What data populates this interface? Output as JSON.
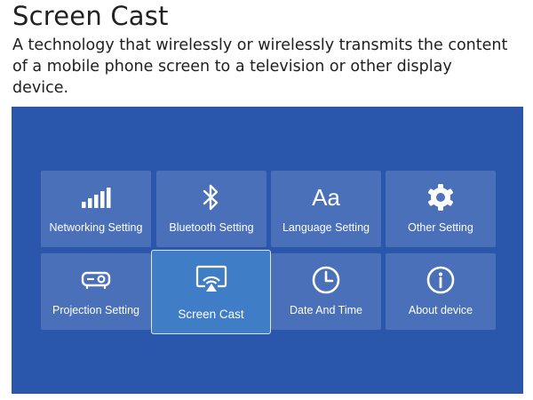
{
  "header": {
    "title": "Screen Cast",
    "description": "A technology that wirelessly or wirelessly transmits the content of a mobile phone screen to a television or other display device."
  },
  "colors": {
    "screen_background": "#2a57ac",
    "tile_background": "rgba(255,255,255,0.15)",
    "selected_tile": "#3f7ec6",
    "text": "#ffffff"
  },
  "menu": {
    "selected": "Screen Cast",
    "tiles": [
      {
        "label": "Networking Setting",
        "icon": "signal-bars-icon"
      },
      {
        "label": "Bluetooth Setting",
        "icon": "bluetooth-icon"
      },
      {
        "label": "Language Setting",
        "icon": "language-icon",
        "glyph": "Aa"
      },
      {
        "label": "Other Setting",
        "icon": "gear-icon"
      },
      {
        "label": "Projection Setting",
        "icon": "projector-icon"
      },
      {
        "label": "Screen Cast",
        "icon": "cast-icon"
      },
      {
        "label": "Date And Time",
        "icon": "clock-icon"
      },
      {
        "label": "About device",
        "icon": "info-icon"
      }
    ]
  }
}
